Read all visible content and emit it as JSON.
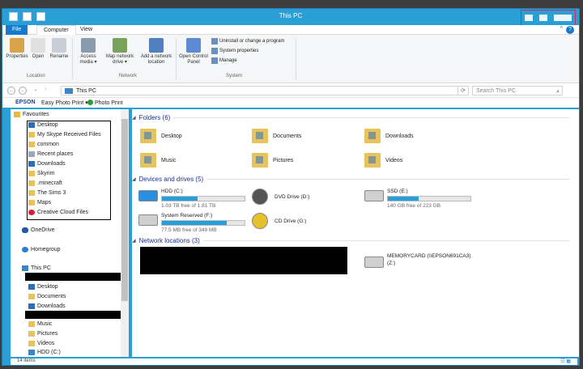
{
  "window": {
    "title": "This PC"
  },
  "ribbon": {
    "tabs": [
      "File",
      "Computer",
      "View"
    ],
    "location": {
      "label": "Location",
      "buttons": [
        "Properties",
        "Open",
        "Rename"
      ]
    },
    "network": {
      "label": "Network",
      "buttons": [
        "Access media ▾",
        "Map network drive ▾",
        "Add a network location"
      ]
    },
    "system": {
      "label": "System",
      "open_cp": "Open Control Panel",
      "items": [
        "Uninstall or change a program",
        "System properties",
        "Manage"
      ]
    }
  },
  "address": {
    "path": "This PC",
    "search_placeholder": "Search This PC"
  },
  "epson": {
    "brand": "EPSON",
    "easy": "Easy Photo Print ▾",
    "photo": "Photo Print"
  },
  "nav": {
    "favourites": "Favourites",
    "fav_items": [
      "Desktop",
      "My Skype Received Files",
      "common",
      "Recent places",
      "Downloads",
      "Skyrim",
      ".minecraft",
      "The Sims 3",
      "Maps",
      "Creative Cloud Files"
    ],
    "onedrive": "OneDrive",
    "homegroup": "Homegroup",
    "thispc": "This PC",
    "pc_items_a": [
      "Desktop",
      "Documents",
      "Downloads"
    ],
    "pc_items_b": [
      "Music",
      "Pictures",
      "Videos",
      "HDD (C:)"
    ]
  },
  "content": {
    "folders_header": "Folders (6)",
    "folders": [
      "Desktop",
      "Documents",
      "Downloads",
      "Music",
      "Pictures",
      "Videos"
    ],
    "drives_header": "Devices and drives (5)",
    "drives": [
      {
        "name": "HDD (C:)",
        "free": "1.03 TB free of 1.81 TB",
        "used": 0.43
      },
      {
        "name": "DVD Drive (D:)"
      },
      {
        "name": "SSD (E:)",
        "free": "140 GB free of 223 GB",
        "used": 0.37
      },
      {
        "name": "System Reserved (F:)",
        "free": "77.5 MB free of 349 MB",
        "used": 0.78
      },
      {
        "name": "CD Drive (G:)"
      }
    ],
    "network_header": "Network locations (3)",
    "network_item": {
      "name": "MEMORYCARD (\\\\EPSON691CA3)",
      "sub": "(Z:)"
    }
  },
  "status": {
    "items": "14 items"
  }
}
